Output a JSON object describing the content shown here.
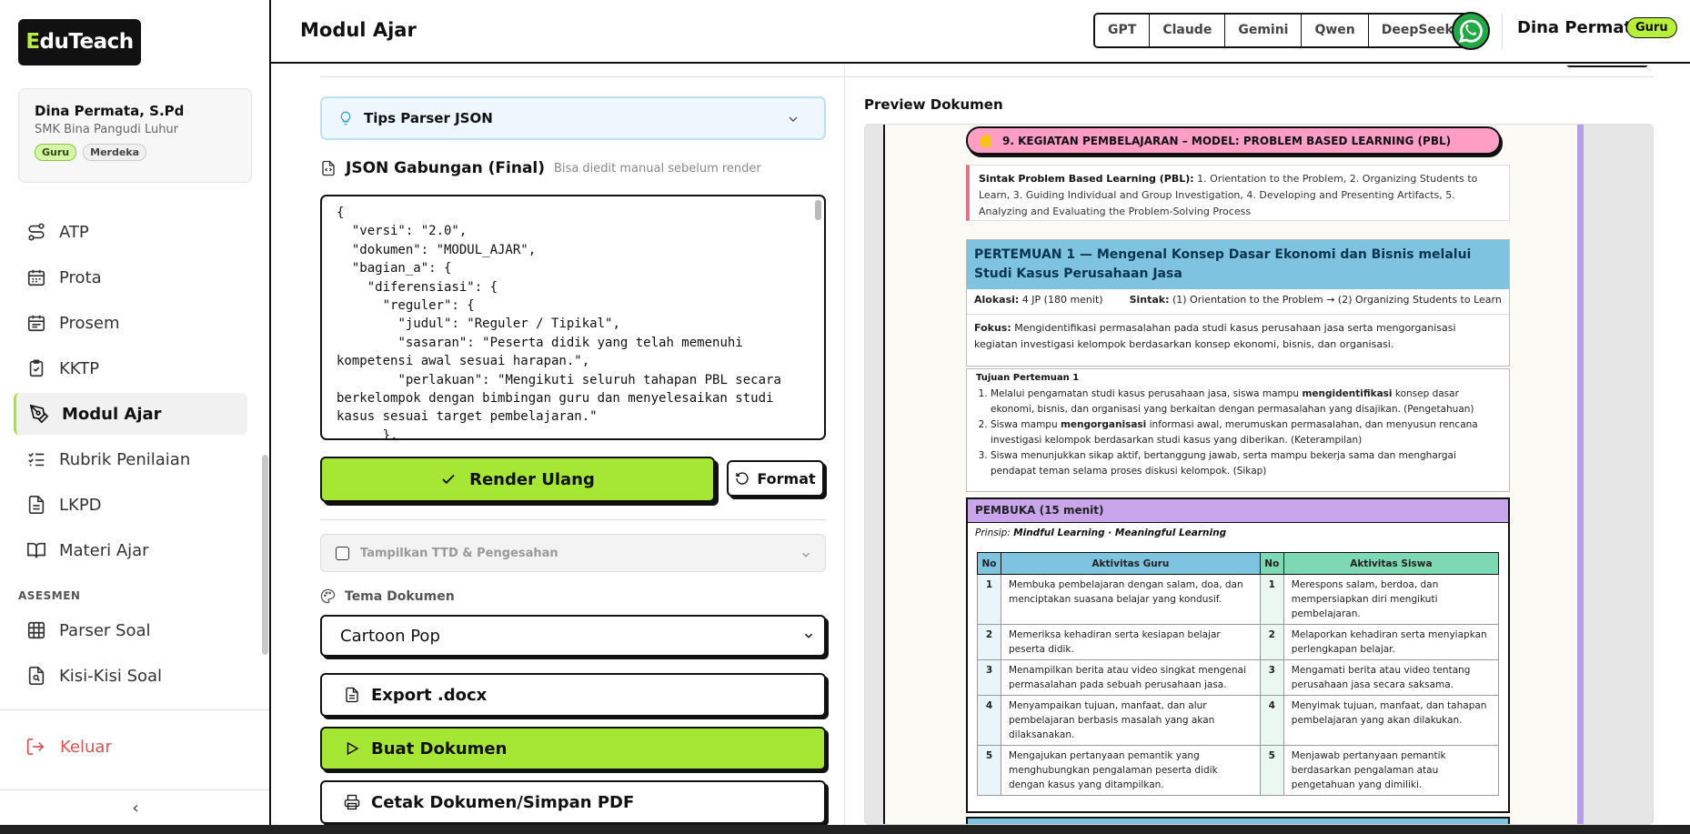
{
  "sidebar": {
    "logo_e": "E",
    "logo_rest": "duTeach",
    "profile": {
      "name": "Dina Permata, S.Pd",
      "school": "SMK Bina Pangudi Luhur",
      "badge1": "Guru",
      "badge2": "Merdeka"
    },
    "items": [
      {
        "label": "ATP",
        "icon": "route-icon"
      },
      {
        "label": "Prota",
        "icon": "calendar-icon"
      },
      {
        "label": "Prosem",
        "icon": "calendar-icon"
      },
      {
        "label": "KKTP",
        "icon": "clipboard-check-icon"
      },
      {
        "label": "Modul Ajar",
        "icon": "pen-tool-icon"
      },
      {
        "label": "Rubrik Penilaian",
        "icon": "list-check-icon"
      },
      {
        "label": "LKPD",
        "icon": "file-text-icon"
      },
      {
        "label": "Materi Ajar",
        "icon": "book-open-icon"
      }
    ],
    "section_asesmen": "ASESMEN",
    "items2": [
      {
        "label": "Parser Soal",
        "icon": "grid-icon"
      },
      {
        "label": "Kisi-Kisi Soal",
        "icon": "file-search-icon"
      }
    ],
    "logout": "Keluar",
    "collapse": "‹"
  },
  "header": {
    "title": "Modul Ajar",
    "ai_models": [
      "GPT",
      "Claude",
      "Gemini",
      "Qwen",
      "DeepSeek"
    ],
    "user": "Dina Permata",
    "user_badge": "Guru"
  },
  "editor": {
    "tips": "Tips Parser JSON",
    "json_title": "JSON Gabungan (Final)",
    "json_sub": "Bisa diedit manual sebelum render",
    "json_text": "{\n  \"versi\": \"2.0\",\n  \"dokumen\": \"MODUL_AJAR\",\n  \"bagian_a\": {\n    \"diferensiasi\": {\n      \"reguler\": {\n        \"judul\": \"Reguler / Tipikal\",\n        \"sasaran\": \"Peserta didik yang telah memenuhi kompetensi awal sesuai harapan.\",\n        \"perlakuan\": \"Mengikuti seluruh tahapan PBL secara berkelompok dengan bimbingan guru dan menyelesaikan studi kasus sesuai target pembelajaran.\"\n      },",
    "render": "Render Ulang",
    "format": "Format",
    "ttd": "Tampilkan TTD & Pengesahan",
    "tema_label": "Tema Dokumen",
    "tema_value": "Cartoon Pop",
    "export": "Export .docx",
    "buat": "Buat Dokumen",
    "cetak": "Cetak Dokumen/Simpan PDF"
  },
  "preview": {
    "title": "Preview Dokumen",
    "kegiatan": "9. KEGIATAN PEMBELAJARAN – MODEL: PROBLEM BASED LEARNING (PBL)",
    "sintak_label": "Sintak Problem Based Learning (PBL):",
    "sintak_text": " 1. Orientation to the Problem, 2. Organizing Students to Learn, 3. Guiding Individual and Group Investigation, 4. Developing and Presenting Artifacts, 5. Analyzing and Evaluating the Problem-Solving Process",
    "pertemuan_title": "PERTEMUAN 1 — Mengenal Konsep Dasar Ekonomi dan Bisnis melalui Studi Kasus Perusahaan Jasa",
    "alokasi_label": "Alokasi:",
    "alokasi_value": " 4 JP (180 menit)",
    "sintak2_label": "Sintak:",
    "sintak2_value": " (1) Orientation to the Problem → (2) Organizing Students to Learn",
    "fokus_label": "Fokus:",
    "fokus_value": " Mengidentifikasi permasalahan pada studi kasus perusahaan jasa serta mengorganisasi kegiatan investigasi kelompok berdasarkan konsep ekonomi, bisnis, dan organisasi.",
    "tujuan_title": "Tujuan Pertemuan 1",
    "tujuan": [
      {
        "pre": "Melalui pengamatan studi kasus perusahaan jasa, siswa mampu ",
        "bold": "mengidentifikasi",
        "post": " konsep dasar ekonomi, bisnis, dan organisasi yang berkaitan dengan permasalahan yang disajikan. (Pengetahuan)"
      },
      {
        "pre": "Siswa mampu ",
        "bold": "mengorganisasi",
        "post": " informasi awal, merumuskan permasalahan, dan menyusun rencana investigasi kelompok berdasarkan studi kasus yang diberikan. (Keterampilan)"
      },
      {
        "pre": "Siswa menunjukkan sikap aktif, bertanggung jawab, serta mampu bekerja sama dan menghargai pendapat teman selama proses diskusi kelompok. (Sikap)",
        "bold": "",
        "post": ""
      }
    ],
    "pembuka_title": "PEMBUKA (15 menit)",
    "prinsip_label": "Prinsip:",
    "prinsip_value": "Mindful Learning · Meaningful Learning",
    "table_headers": [
      "No",
      "Aktivitas Guru",
      "No",
      "Aktivitas Siswa"
    ],
    "rows": [
      {
        "no": "1",
        "guru": "Membuka pembelajaran dengan salam, doa, dan menciptakan suasana belajar yang kondusif.",
        "siswa": "Merespons salam, berdoa, dan mempersiapkan diri mengikuti pembelajaran."
      },
      {
        "no": "2",
        "guru": "Memeriksa kehadiran serta kesiapan belajar peserta didik.",
        "siswa": "Melaporkan kehadiran serta menyiapkan perlengkapan belajar."
      },
      {
        "no": "3",
        "guru": "Menampilkan berita atau video singkat mengenai permasalahan pada sebuah perusahaan jasa.",
        "siswa": "Mengamati berita atau video tentang perusahaan jasa secara saksama."
      },
      {
        "no": "4",
        "guru": "Menyampaikan tujuan, manfaat, dan alur pembelajaran berbasis masalah yang akan dilaksanakan.",
        "siswa": "Menyimak tujuan, manfaat, dan tahapan pembelajaran yang akan dilakukan."
      },
      {
        "no": "5",
        "guru": "Mengajukan pertanyaan pemantik yang menghubungkan pengalaman peserta didik dengan kasus yang ditampilkan.",
        "siswa": "Menjawab pertanyaan pemantik berdasarkan pengalaman atau pengetahuan yang dimiliki."
      }
    ]
  },
  "colors": {
    "accent": "#a6e635",
    "dark": "#111111",
    "danger": "#e05252",
    "whatsapp": "#22a844"
  }
}
